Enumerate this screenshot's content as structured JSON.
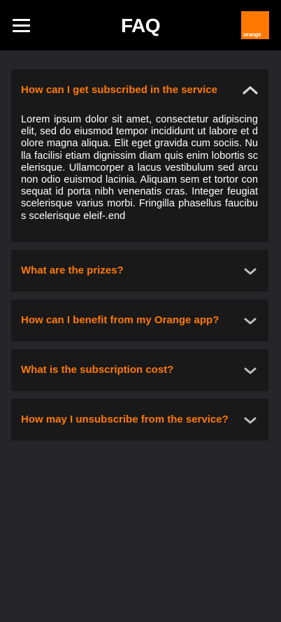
{
  "header": {
    "title": "FAQ",
    "menu_icon": "hamburger-menu-icon",
    "logo_text": "orange",
    "logo_color": "#ff7900",
    "background": "#000000"
  },
  "faq": {
    "accent_color": "#ff7900",
    "items": [
      {
        "question": "How can I get subscribed in the service",
        "expanded": true,
        "icon": "chevron-up-icon",
        "answer": "Lorem ipsum dolor sit amet, consectetur adipiscing elit, sed do eiusmod tempor incididunt ut labore et dolore magna aliqua. Elit eget gravida cum sociis. Nulla facilisi etiam dignissim diam quis enim lobortis scelerisque. Ullamcorper a lacus vestibulum sed arcu non odio euismod lacinia. Aliquam sem et tortor consequat id porta nibh venenatis cras. Integer feugiat scelerisque varius morbi. Fringilla phasellus faucibus scelerisque eleif-.end"
      },
      {
        "question": "What are the prizes?",
        "expanded": false,
        "icon": "chevron-down-icon"
      },
      {
        "question": "How can I benefit from my Orange app?",
        "expanded": false,
        "icon": "chevron-down-icon"
      },
      {
        "question": "What is the subscription cost?",
        "expanded": false,
        "icon": "chevron-down-icon"
      },
      {
        "question": "How may I unsubscribe from the service?",
        "expanded": false,
        "icon": "chevron-down-icon"
      }
    ]
  }
}
